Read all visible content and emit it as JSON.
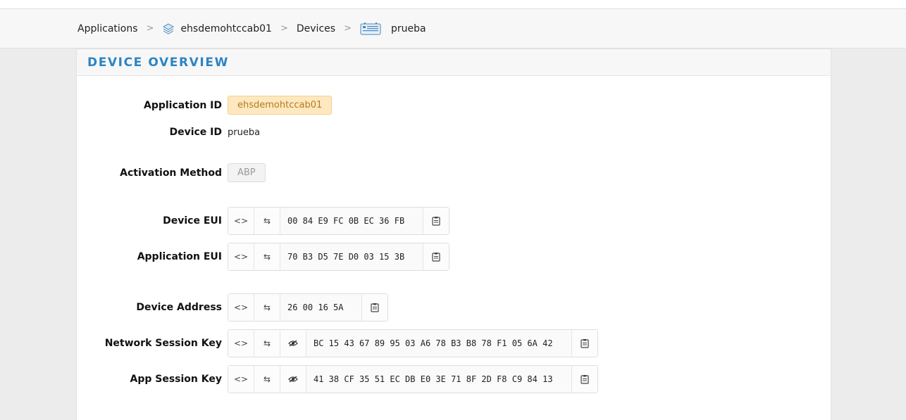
{
  "breadcrumb": {
    "applications": "Applications",
    "app_name": "ehsdemohtccab01",
    "devices": "Devices",
    "device_name": "prueba",
    "separator": ">"
  },
  "panel": {
    "title": "DEVICE OVERVIEW"
  },
  "fields": {
    "application_id": {
      "label": "Application ID",
      "value": "ehsdemohtccab01"
    },
    "device_id": {
      "label": "Device ID",
      "value": "prueba"
    },
    "activation_method": {
      "label": "Activation Method",
      "value": "ABP"
    },
    "device_eui": {
      "label": "Device EUI",
      "value": "00 84 E9 FC 0B EC 36 FB"
    },
    "application_eui": {
      "label": "Application EUI",
      "value": "70 B3 D5 7E D0 03 15 3B"
    },
    "device_address": {
      "label": "Device Address",
      "value": "26 00 16 5A"
    },
    "network_session_key": {
      "label": "Network Session Key",
      "value": "BC 15 43 67 89 95 03 A6 78 B3 B8 78 F1 05 6A 42"
    },
    "app_session_key": {
      "label": "App Session Key",
      "value": "41 38 CF 35 51 EC DB E0 3E 71 8F 2D F8 C9 84 13"
    }
  },
  "buttons": {
    "format_toggle": "<>",
    "byte_order": "⇆",
    "visibility": "👁",
    "copy": "clipboard-icon"
  },
  "colors": {
    "accent": "#2b84c4",
    "app_badge_bg": "#fde8bf",
    "app_badge_text": "#b57a20"
  }
}
